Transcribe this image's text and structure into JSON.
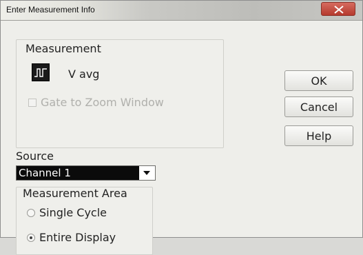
{
  "dialog": {
    "title": "Enter Measurement Info",
    "measurement": {
      "label": "Measurement",
      "name": "V avg",
      "icon": "waveform-icon"
    },
    "gate_option": {
      "label": "Gate to Zoom Window",
      "checked": false,
      "enabled": false
    },
    "buttons": {
      "ok": "OK",
      "cancel": "Cancel",
      "help": "Help"
    },
    "source": {
      "label": "Source",
      "selected": "Channel 1"
    },
    "measurement_area": {
      "label": "Measurement Area",
      "options": [
        {
          "label": "Single Cycle",
          "selected": false
        },
        {
          "label": "Entire Display",
          "selected": true
        }
      ]
    }
  }
}
